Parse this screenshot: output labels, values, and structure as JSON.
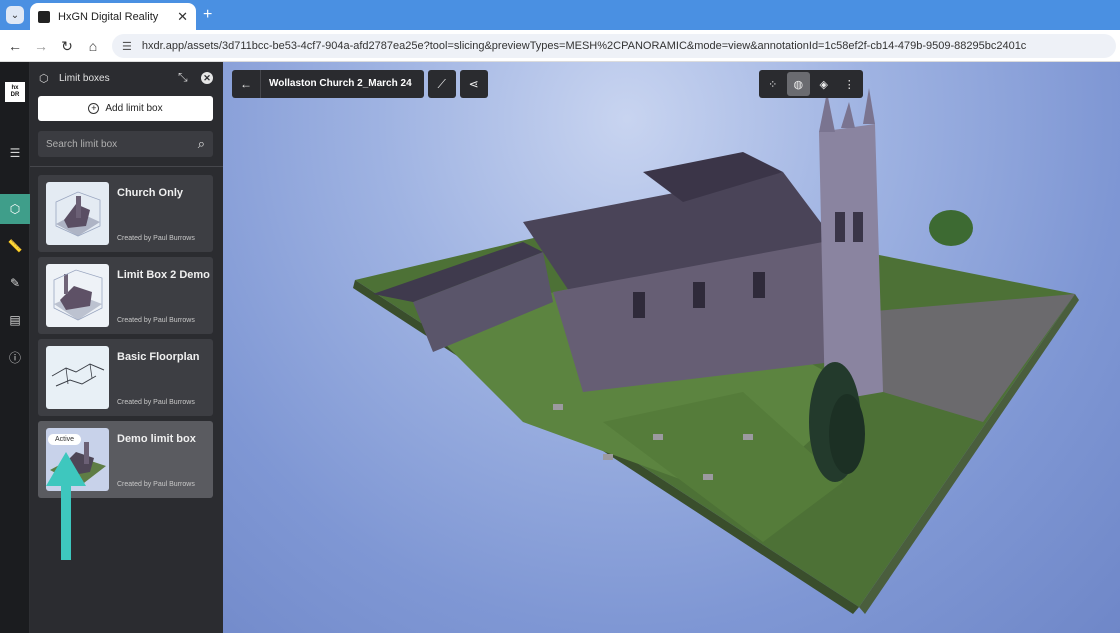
{
  "browser": {
    "tab_title": "HxGN Digital Reality",
    "url": "hxdr.app/assets/3d711bcc-be53-4cf7-904a-afd2787ea25e?tool=slicing&previewTypes=MESH%2CPANORAMIC&mode=view&annotationId=1c58ef2f-cb14-479b-9509-88295bc2401c"
  },
  "rail": {
    "logo_text": "hx DR",
    "items": [
      "menu-icon",
      "cube-icon",
      "ruler-icon",
      "annotation-icon",
      "layers-icon",
      "info-icon"
    ]
  },
  "panel": {
    "title": "Limit boxes",
    "add_label": "Add limit box",
    "search_placeholder": "Search limit box",
    "items": [
      {
        "title": "Church Only",
        "creator": "Created by Paul Burrows"
      },
      {
        "title": "Limit Box 2 Demo",
        "creator": "Created by Paul Burrows"
      },
      {
        "title": "Basic Floorplan",
        "creator": "Created by Paul Burrows"
      },
      {
        "title": "Demo limit box",
        "creator": "Created by Paul Burrows",
        "badge": "Active"
      }
    ]
  },
  "viewer": {
    "asset_title": "Wollaston Church 2_March 24"
  },
  "colors": {
    "accent": "#3f9e8a",
    "arrow": "#3ec7be"
  }
}
